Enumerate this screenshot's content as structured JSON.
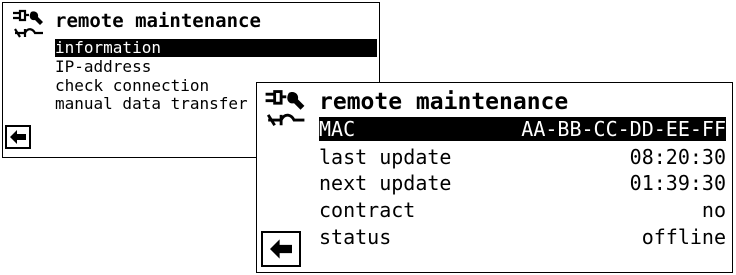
{
  "back_screen": {
    "title": "remote maintenance",
    "menu": [
      {
        "label": "information",
        "selected": true
      },
      {
        "label": "IP-address",
        "selected": false
      },
      {
        "label": "check connection",
        "selected": false
      },
      {
        "label": "manual data transfer",
        "selected": false
      }
    ],
    "back_icon": "arrow-left-icon",
    "tool_icon": "wrench-plug-icon"
  },
  "front_screen": {
    "title": "remote maintenance",
    "mac": {
      "label": "MAC",
      "value": "AA-BB-CC-DD-EE-FF"
    },
    "last_update": {
      "label": "last update",
      "value": "08:20:30"
    },
    "next_update": {
      "label": "next update",
      "value": "01:39:30"
    },
    "contract": {
      "label": "contract",
      "value": "no"
    },
    "status": {
      "label": "status",
      "value": "offline"
    },
    "back_icon": "arrow-left-icon",
    "tool_icon": "wrench-plug-icon"
  }
}
